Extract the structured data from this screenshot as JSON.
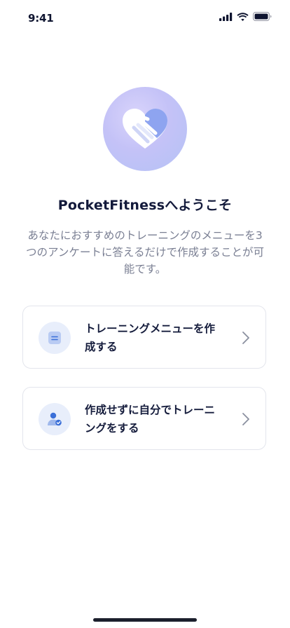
{
  "status_bar": {
    "time": "9:41"
  },
  "icons": {
    "hero": "handshake-heart-icon",
    "option_1": "document-icon",
    "option_2": "user-check-icon",
    "chevron": "chevron-right-icon"
  },
  "colors": {
    "primary_text": "#131a3b",
    "secondary_text": "#7a7f93",
    "accent": "#3b6fd8",
    "card_border": "#e3e5ec",
    "icon_bg": "#e8eefb"
  },
  "welcome": {
    "title": "PocketFitnessへようこそ",
    "description": "あなたにおすすめのトレーニングのメニューを3つのアンケートに答えるだけで作成することが可能です。"
  },
  "options": [
    {
      "label": "トレーニングメニューを作成する"
    },
    {
      "label": "作成せずに自分でトレーニングをする"
    }
  ]
}
